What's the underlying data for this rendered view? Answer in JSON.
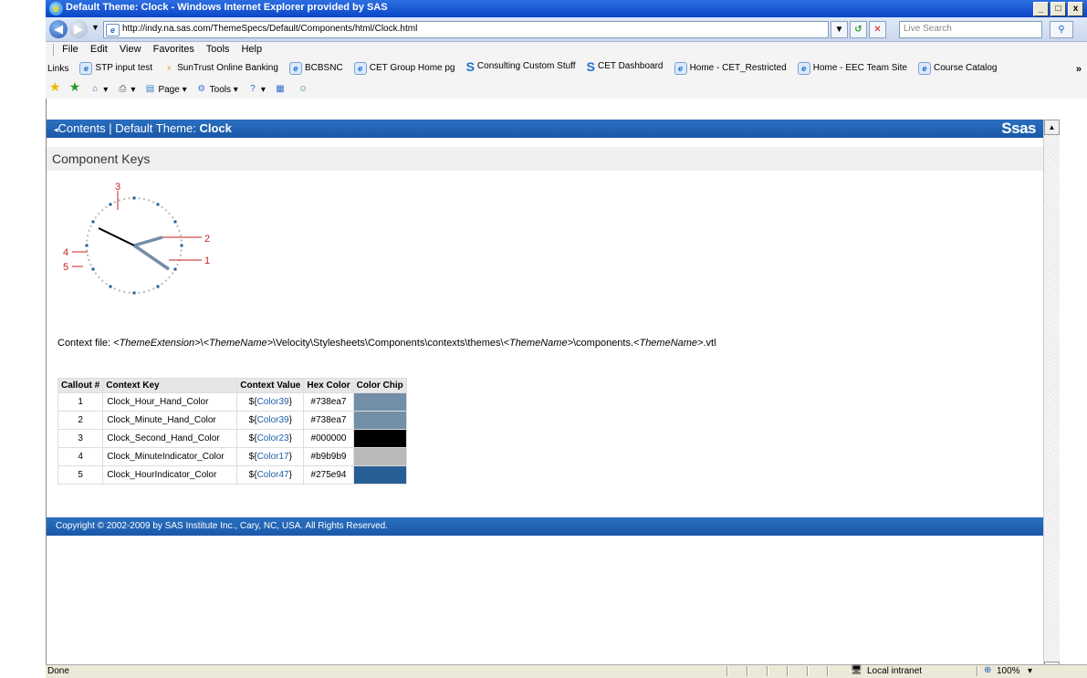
{
  "window": {
    "title": "Default Theme: Clock - Windows Internet Explorer provided by SAS",
    "minimize": "_",
    "maximize": "□",
    "close": "x"
  },
  "address": {
    "url": "http://indy.na.sas.com/ThemeSpecs/Default/Components/html/Clock.html",
    "search_placeholder": "Live Search"
  },
  "menu": [
    "File",
    "Edit",
    "View",
    "Favorites",
    "Tools",
    "Help"
  ],
  "links": {
    "label": "Links",
    "items": [
      {
        "label": "STP input test",
        "icon": "ie-page-icon"
      },
      {
        "label": "SunTrust Online Banking",
        "icon": "suntrust-icon"
      },
      {
        "label": "BCBSNC",
        "icon": "ie-page-icon"
      },
      {
        "label": "CET Group Home pg",
        "icon": "ie-page-icon"
      },
      {
        "label": "Consulting Custom Stuff",
        "icon": "sas-s-icon"
      },
      {
        "label": "CET Dashboard",
        "icon": "sas-s-icon"
      },
      {
        "label": "Home - CET_Restricted",
        "icon": "ie-page-icon"
      },
      {
        "label": "Home - EEC Team Site",
        "icon": "ie-page-icon"
      },
      {
        "label": "Course Catalog",
        "icon": "ie-page-icon"
      }
    ],
    "more": "»"
  },
  "commandbar": {
    "page": "Page",
    "tools": "Tools"
  },
  "header": {
    "back_link": "Contents",
    "separator": "|",
    "title_prefix": "Default Theme:",
    "title_bold": "Clock",
    "logo": "Ssas"
  },
  "section_title": "Component Keys",
  "clock_callouts": [
    {
      "n": "1"
    },
    {
      "n": "2"
    },
    {
      "n": "3"
    },
    {
      "n": "4"
    },
    {
      "n": "5"
    }
  ],
  "context_file": {
    "prefix": "Context file: ",
    "p1": "<ThemeExtension>",
    "s1": "\\",
    "p2": "<ThemeName>",
    "s2": "\\Velocity\\Stylesheets\\Components\\contexts\\themes\\",
    "p3": "<ThemeName>",
    "s3": "\\components.",
    "p4": "<ThemeName>",
    "s4": ".vtl"
  },
  "table": {
    "headers": [
      "Callout #",
      "Context Key",
      "Context Value",
      "Hex Color",
      "Color Chip"
    ],
    "rows": [
      {
        "callout": "1",
        "key": "Clock_Hour_Hand_Color",
        "v_pre": "${",
        "v_link": "Color39",
        "v_post": "}",
        "hex": "#738ea7",
        "chip": "#738ea7"
      },
      {
        "callout": "2",
        "key": "Clock_Minute_Hand_Color",
        "v_pre": "${",
        "v_link": "Color39",
        "v_post": "}",
        "hex": "#738ea7",
        "chip": "#738ea7"
      },
      {
        "callout": "3",
        "key": "Clock_Second_Hand_Color",
        "v_pre": "${",
        "v_link": "Color23",
        "v_post": "}",
        "hex": "#000000",
        "chip": "#000000"
      },
      {
        "callout": "4",
        "key": "Clock_MinuteIndicator_Color",
        "v_pre": "${",
        "v_link": "Color17",
        "v_post": "}",
        "hex": "#b9b9b9",
        "chip": "#b9b9b9"
      },
      {
        "callout": "5",
        "key": "Clock_HourIndicator_Color",
        "v_pre": "${",
        "v_link": "Color47",
        "v_post": "}",
        "hex": "#275e94",
        "chip": "#275e94"
      }
    ]
  },
  "footer": "Copyright © 2002-2009 by SAS Institute Inc., Cary, NC, USA. All Rights Reserved.",
  "status": {
    "text": "Done",
    "zone": "Local intranet",
    "zoom": "100%"
  },
  "colors": {
    "header_blue": "#1a58a8",
    "callout_red": "#cc2020",
    "hand_color": "#738ea7",
    "second_hand": "#000000",
    "minute_indicator": "#b9b9b9",
    "hour_indicator": "#275e94"
  }
}
